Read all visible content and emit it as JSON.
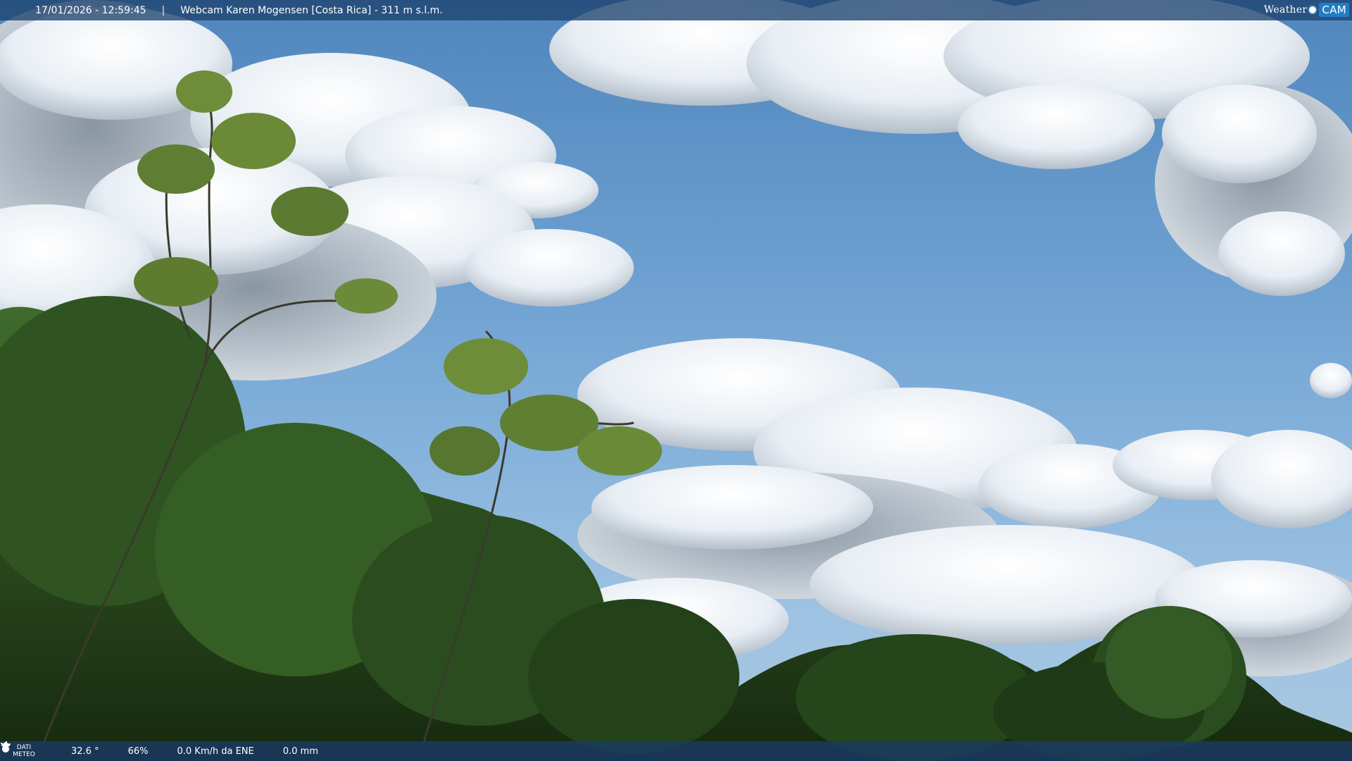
{
  "header": {
    "datetime": "17/01/2026 - 12:59:45",
    "separator": "|",
    "title": "Webcam Karen Mogensen [Costa Rica] - 311 m s.l.m."
  },
  "logo": {
    "weather_text": "Weather",
    "cam_text": "CAM"
  },
  "footer": {
    "label_line1": "DATI",
    "label_line2": "METEO",
    "temperature": "32.6 °",
    "humidity": "66%",
    "wind": "0.0 Km/h da ENE",
    "rain": "0.0 mm",
    "icons": [
      "thermometer-icon",
      "humidity-drop-icon",
      "wind-icon",
      "rain-gauge-icon"
    ]
  },
  "colors": {
    "sky_top": "#4f86bd",
    "sky_bottom": "#a9c8e0",
    "bar_bg": "#1e426e",
    "logo_accent": "#1f7ec6"
  }
}
